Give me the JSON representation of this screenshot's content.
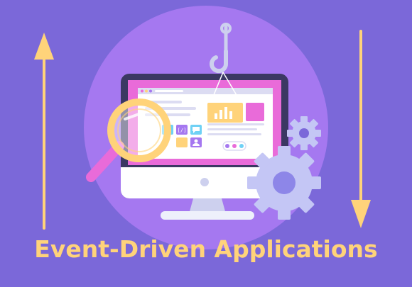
{
  "headline": {
    "text": "Event-Driven Applications"
  },
  "screen_text": {
    "code_tile": "[/]"
  },
  "icons": {
    "up_arrow": "arrow-up-icon",
    "down_arrow": "arrow-down-icon",
    "hook": "hook-icon",
    "magnifier": "magnifying-glass-icon",
    "gear_large": "gear-icon",
    "gear_small": "gear-icon",
    "chart": "bar-chart-icon"
  },
  "colors": {
    "background": "#7b68d9",
    "circle": "#a578f0",
    "accent_yellow": "#ffd37a",
    "pink": "#e96bd9",
    "monitor_frame": "#3b3863",
    "gear": "#c4c6f5"
  }
}
